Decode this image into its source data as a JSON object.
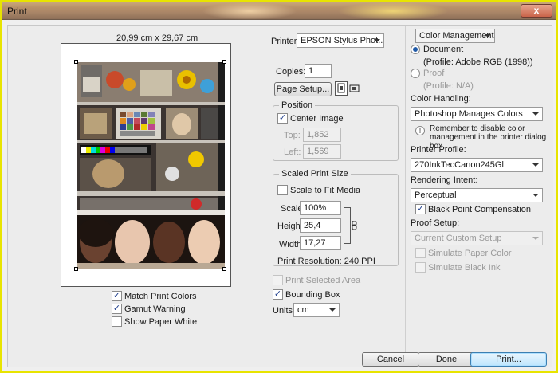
{
  "window": {
    "title": "Print",
    "close_label": "x"
  },
  "preview": {
    "paper_size": "20,99 cm x 29,67 cm",
    "match_print_colors": "Match Print Colors",
    "gamut_warning": "Gamut Warning",
    "show_paper_white": "Show Paper White"
  },
  "printer": {
    "label": "Printer:",
    "value": "EPSON Stylus Phot...",
    "copies_label": "Copies:",
    "copies_value": "1",
    "page_setup_label": "Page Setup..."
  },
  "position": {
    "title": "Position",
    "center_image": "Center Image",
    "top_label": "Top:",
    "top_value": "1,852",
    "left_label": "Left:",
    "left_value": "1,569"
  },
  "scaled": {
    "title": "Scaled Print Size",
    "scale_to_fit": "Scale to Fit Media",
    "scale_label": "Scale:",
    "scale_value": "100%",
    "height_label": "Height:",
    "height_value": "25,4",
    "width_label": "Width:",
    "width_value": "17,27",
    "resolution": "Print Resolution: 240 PPI",
    "print_selected": "Print Selected Area",
    "bounding_box": "Bounding Box",
    "units_label": "Units:",
    "units_value": "cm"
  },
  "color": {
    "section": "Color Management",
    "document": "Document",
    "document_profile": "(Profile: Adobe RGB (1998))",
    "proof": "Proof",
    "proof_profile": "(Profile: N/A)",
    "handling_label": "Color Handling:",
    "handling_value": "Photoshop Manages Colors",
    "notice": "Remember to disable color management in the printer dialog box.",
    "printer_profile_label": "Printer Profile:",
    "printer_profile_value": "270InkTecCanon245Gl",
    "intent_label": "Rendering Intent:",
    "intent_value": "Perceptual",
    "black_point": "Black Point Compensation",
    "proof_setup_label": "Proof Setup:",
    "proof_setup_value": "Current Custom Setup",
    "simulate_paper": "Simulate Paper Color",
    "simulate_black": "Simulate Black Ink"
  },
  "buttons": {
    "cancel": "Cancel",
    "done": "Done",
    "print": "Print..."
  },
  "colors": {
    "accent": "#3c7fb1",
    "titlebar": "#a98567",
    "frame": "#e8e400"
  }
}
